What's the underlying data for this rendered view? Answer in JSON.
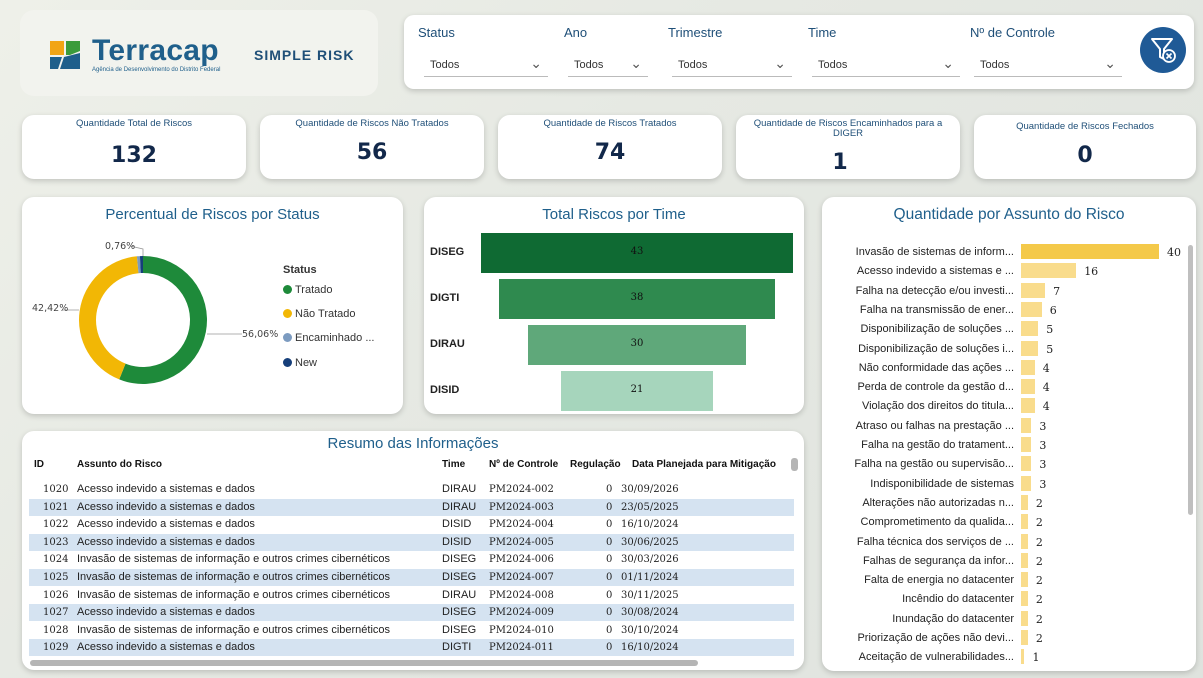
{
  "brand": {
    "name": "Terracap",
    "subtitle": "Agência de Desenvolvimento do Distrito Federal",
    "app_title": "SIMPLE RISK"
  },
  "filters": [
    {
      "label": "Status",
      "value": "Todos"
    },
    {
      "label": "Ano",
      "value": "Todos"
    },
    {
      "label": "Trimestre",
      "value": "Todos"
    },
    {
      "label": "Time",
      "value": "Todos"
    },
    {
      "label": "Nº de Controle",
      "value": "Todos"
    }
  ],
  "kpis": [
    {
      "label": "Quantidade Total de Riscos",
      "value": "132"
    },
    {
      "label": "Quantidade de Riscos Não Tratados",
      "value": "56"
    },
    {
      "label": "Quantidade de Riscos Tratados",
      "value": "74"
    },
    {
      "label": "Quantidade de Riscos Encaminhados para a DIGER",
      "value": "1"
    },
    {
      "label": "Quantidade de Riscos Fechados",
      "value": "0"
    }
  ],
  "donut": {
    "title": "Percentual de Riscos por Status",
    "legend_title": "Status",
    "labels": {
      "tratado": "56,06%",
      "nao_tratado": "42,42%",
      "encaminhado": "0,76%"
    }
  },
  "funnel": {
    "title": "Total Riscos por Time"
  },
  "subjects": {
    "title": "Quantidade por Assunto do Risco"
  },
  "table": {
    "title": "Resumo das Informações",
    "headers": [
      "ID",
      "Assunto do Risco",
      "Time",
      "Nº de Controle",
      "Regulação",
      "Data Planejada para Mitigação"
    ],
    "rows": [
      [
        "1020",
        "Acesso indevido a sistemas e dados",
        "DIRAU",
        "PM2024-002",
        "0",
        "30/09/2026"
      ],
      [
        "1021",
        "Acesso indevido a sistemas e dados",
        "DIRAU",
        "PM2024-003",
        "0",
        "23/05/2025"
      ],
      [
        "1022",
        "Acesso indevido a sistemas e dados",
        "DISID",
        "PM2024-004",
        "0",
        "16/10/2024"
      ],
      [
        "1023",
        "Acesso indevido a sistemas e dados",
        "DISID",
        "PM2024-005",
        "0",
        "30/06/2025"
      ],
      [
        "1024",
        "Invasão de sistemas de informação e outros crimes cibernéticos",
        "DISEG",
        "PM2024-006",
        "0",
        "30/03/2026"
      ],
      [
        "1025",
        "Invasão de sistemas de informação e outros crimes cibernéticos",
        "DISEG",
        "PM2024-007",
        "0",
        "01/11/2024"
      ],
      [
        "1026",
        "Invasão de sistemas de informação e outros crimes cibernéticos",
        "DIRAU",
        "PM2024-008",
        "0",
        "30/11/2025"
      ],
      [
        "1027",
        "Acesso indevido a sistemas e dados",
        "DISEG",
        "PM2024-009",
        "0",
        "30/08/2024"
      ],
      [
        "1028",
        "Invasão de sistemas de informação e outros crimes cibernéticos",
        "DISEG",
        "PM2024-010",
        "0",
        "30/10/2024"
      ],
      [
        "1029",
        "Acesso indevido a sistemas e dados",
        "DIGTI",
        "PM2024-011",
        "0",
        "16/10/2024"
      ]
    ]
  },
  "chart_data": [
    {
      "type": "pie",
      "title": "Percentual de Riscos por Status",
      "legend_title": "Status",
      "categories": [
        "Tratado",
        "Não Tratado",
        "Encaminhado ...",
        "New"
      ],
      "values": [
        56.06,
        42.42,
        0.76,
        0.76
      ],
      "colors": [
        "#1e8a3a",
        "#f2b705",
        "#7c9bc0",
        "#163f7a"
      ],
      "legend": "right"
    },
    {
      "type": "bar",
      "title": "Total Riscos por Time",
      "categories": [
        "DISEG",
        "DIGTI",
        "DIRAU",
        "DISID"
      ],
      "values": [
        43,
        38,
        30,
        21
      ],
      "colors": [
        "#0f6a33",
        "#2f8a4f",
        "#5fa87a",
        "#a6d5bc"
      ]
    },
    {
      "type": "bar",
      "title": "Quantidade por Assunto do Risco",
      "categories": [
        "Invasão de sistemas de inform...",
        "Acesso indevido a sistemas e ...",
        "Falha na detecção e/ou investi...",
        "Falha na transmissão de ener...",
        "Disponibilização de soluções ...",
        "Disponibilização de soluções i...",
        "Não conformidade das ações ...",
        "Perda de controle da gestão d...",
        "Violação dos direitos do titula...",
        "Atraso ou falhas na prestação ...",
        "Falha na gestão do tratament...",
        "Falha na gestão ou supervisão...",
        "Indisponibilidade de sistemas",
        "Alterações não autorizadas n...",
        "Comprometimento da qualida...",
        "Falha técnica dos serviços de ...",
        "Falhas de segurança da infor...",
        "Falta de energia no datacenter",
        "Incêndio do datacenter",
        "Inundação do datacenter",
        "Priorização de ações não devi...",
        "Aceitação de vulnerabilidades..."
      ],
      "values": [
        40,
        16,
        7,
        6,
        5,
        5,
        4,
        4,
        4,
        3,
        3,
        3,
        3,
        2,
        2,
        2,
        2,
        2,
        2,
        2,
        2,
        1
      ],
      "colors": [
        "#f4c94a",
        "#f9dc8c"
      ]
    }
  ]
}
